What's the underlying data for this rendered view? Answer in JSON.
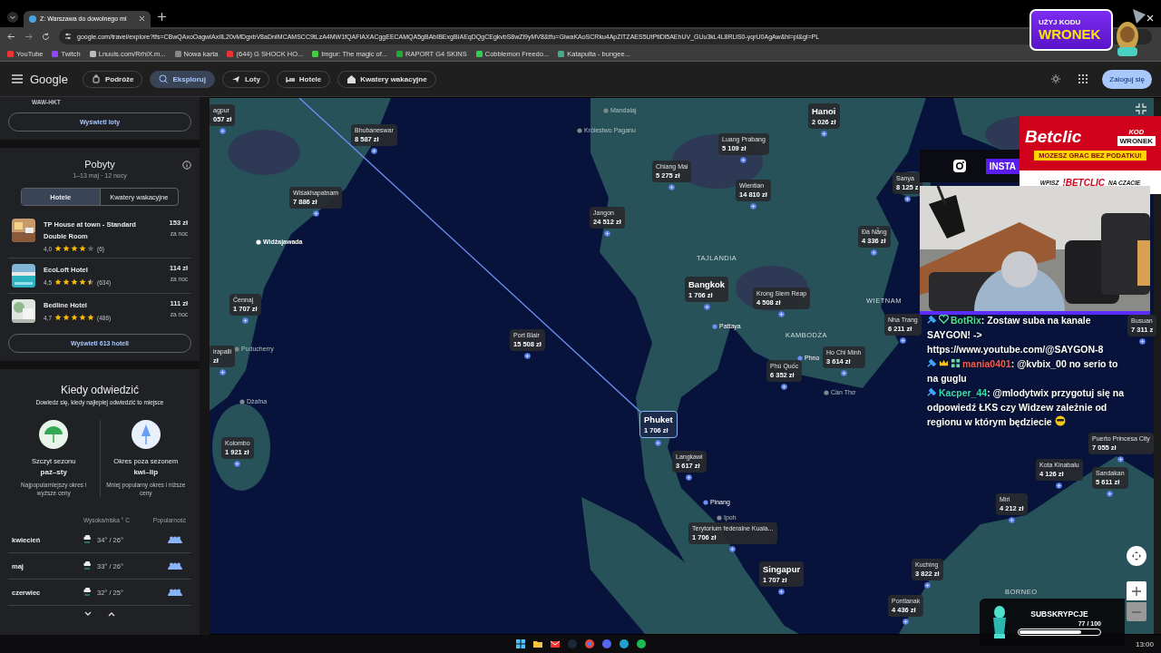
{
  "browser": {
    "tabs": [
      {
        "title": "Z: Warszawa do dowolnego mi",
        "selected": true
      }
    ],
    "url": "google.com/travel/explore?tfs=CBwQAxoOagwIAxIIL20vMDgxbV8aDnIMCAMSCC9tLzA4MW1fQAFIAXACggEECAMQA5gBAbIBExgBIAEqDQgCEgkvbS8wZl9yMV8&tfu=GiwaKAoSCRku4ApZiTZAES5UtPtiDl5AEhUV_GUu3kL4L8RLlS0-yqrU0AgAw&hl=pl&gl=PL",
    "bookmarks": [
      "YouTube",
      "Twitch",
      "Lnuuls.com/RrhiX.m...",
      "Nowa karta",
      "(644) G SHOCK HO...",
      "Imgur: The magic of...",
      "RAPORT G4 SKINS",
      "Cobblemon Freedo...",
      "Katapulta - bungee..."
    ]
  },
  "header": {
    "logo": "Google",
    "nav": [
      {
        "label": "Podróże",
        "selected": false
      },
      {
        "label": "Eksploruj",
        "selected": true
      },
      {
        "label": "Loty",
        "selected": false
      },
      {
        "label": "Hotele",
        "selected": false
      },
      {
        "label": "Kwatery wakacyjne",
        "selected": false
      }
    ],
    "login": "Zaloguj się"
  },
  "sidebar": {
    "flights": {
      "route": "WAW-HKT",
      "button": "Wyświetl loty"
    },
    "stays": {
      "title": "Pobyty",
      "dates": "1–13 maj · 12 nocy",
      "toggle": [
        {
          "label": "Hotele",
          "selected": true
        },
        {
          "label": "Kwatery wakacyjne",
          "selected": false
        }
      ],
      "hotels": [
        {
          "name": "TP House at town - Standard Double Room",
          "rating": "4,0",
          "stars": 4,
          "reviews": "(6)",
          "price": "153 zł",
          "unit": "za noc"
        },
        {
          "name": "EcoLoft Hotel",
          "rating": "4,5",
          "stars": 4.5,
          "reviews": "(634)",
          "price": "114 zł",
          "unit": "za noc"
        },
        {
          "name": "Bedline Hotel",
          "rating": "4,7",
          "stars": 5,
          "reviews": "(486)",
          "price": "111 zł",
          "unit": "za noc"
        }
      ],
      "button": "Wyświetl 613 hoteli"
    },
    "when": {
      "title": "Kiedy odwiedzić",
      "subtitle": "Dowiedz się, kiedy najlepiej odwiedzić to miejsce",
      "seasons": [
        {
          "kind": "peak",
          "label": "Szczyt sezonu",
          "months": "paź–sty",
          "note": "Najpopularniejszy okres i wyższe ceny"
        },
        {
          "kind": "off",
          "label": "Okres poza sezonem",
          "months": "kwi–lip",
          "note": "Mniej popularny okres i niższe ceny"
        }
      ],
      "columns": [
        "Wysoka/niska ° C",
        "Popularność"
      ],
      "months": [
        {
          "month": "kwiecień",
          "temps": "34° / 26°"
        },
        {
          "month": "maj",
          "temps": "33° / 26°"
        },
        {
          "month": "czerwiec",
          "temps": "32° / 25°"
        }
      ]
    }
  },
  "map": {
    "markers": [
      {
        "name": "agpur",
        "price": "057 zł",
        "kind": "minor",
        "selected": false
      },
      {
        "name": "Bhubaneswar",
        "price": "8 587 zł",
        "kind": "minor",
        "selected": false
      },
      {
        "name": "Wiśakhapatnam",
        "price": "7 886 zł",
        "kind": "minor",
        "selected": false
      },
      {
        "name": "Chiang Mai",
        "price": "5 275 zł",
        "kind": "minor",
        "selected": false
      },
      {
        "name": "Luang Prabang",
        "price": "5 109 zł",
        "kind": "minor",
        "selected": false
      },
      {
        "name": "Hanoi",
        "price": "2 026 zł",
        "kind": "major",
        "selected": false
      },
      {
        "name": "Jangon",
        "price": "24 512 zł",
        "kind": "minor",
        "selected": false
      },
      {
        "name": "Wientian",
        "price": "14 810 zł",
        "kind": "minor",
        "selected": false
      },
      {
        "name": "Sanya",
        "price": "8 125 z",
        "kind": "minor",
        "selected": false
      },
      {
        "name": "Đà Nẵng",
        "price": "4 336 zł",
        "kind": "minor",
        "selected": false
      },
      {
        "name": "Bangkok",
        "price": "1 706 zł",
        "kind": "major",
        "selected": false
      },
      {
        "name": "Krong Siem Reap",
        "price": "4 508 zł",
        "kind": "minor",
        "selected": false
      },
      {
        "name": "Ćennaj",
        "price": "1 707 zł",
        "kind": "minor",
        "selected": false
      },
      {
        "name": "irapalli",
        "price": "zł",
        "kind": "minor",
        "selected": false
      },
      {
        "name": "Nha Trang",
        "price": "6 211 zł",
        "kind": "minor",
        "selected": false
      },
      {
        "name": "Port Blair",
        "price": "15 508 zł",
        "kind": "minor",
        "selected": false
      },
      {
        "name": "Ho Chi Minh",
        "price": "3 614 zł",
        "kind": "minor",
        "selected": false
      },
      {
        "name": "Phú Quốc",
        "price": "6 352 zł",
        "kind": "minor",
        "selected": false
      },
      {
        "name": "Phuket",
        "price": "1 706 zł",
        "kind": "major",
        "selected": true
      },
      {
        "name": "Kolombo",
        "price": "1 921 zł",
        "kind": "minor",
        "selected": false
      },
      {
        "name": "Langkawi",
        "price": "3 617 zł",
        "kind": "minor",
        "selected": false
      },
      {
        "name": "Terytorium federalne Kuala...",
        "price": "1 706 zł",
        "kind": "minor",
        "selected": false
      },
      {
        "name": "Singapur",
        "price": "1 707 zł",
        "kind": "major",
        "selected": false
      },
      {
        "name": "Busuan",
        "price": "7 311 z",
        "kind": "minor",
        "selected": false
      },
      {
        "name": "Puerto Princesa City",
        "price": "7 055 zł",
        "kind": "minor",
        "selected": false
      },
      {
        "name": "Kota Kinabalu",
        "price": "4 126 zł",
        "kind": "minor",
        "selected": false
      },
      {
        "name": "Sandakan",
        "price": "5 611 zł",
        "kind": "minor",
        "selected": false
      },
      {
        "name": "Miri",
        "price": "4 212 zł",
        "kind": "minor",
        "selected": false
      },
      {
        "name": "Kuching",
        "price": "3 822 zł",
        "kind": "minor",
        "selected": false
      },
      {
        "name": "Pontianak",
        "price": "4 436 zł",
        "kind": "minor",
        "selected": false
      }
    ],
    "places": [
      {
        "name": "Widżajawada",
        "kind": "city"
      },
      {
        "name": "Puducherry",
        "kind": "town"
      },
      {
        "name": "Dżafna",
        "kind": "town"
      },
      {
        "name": "Mandalaj",
        "kind": "town"
      },
      {
        "name": "Królestwo Paganu",
        "kind": "town"
      },
      {
        "name": "TAJLANDIA",
        "kind": "region"
      },
      {
        "name": "WIETNAM",
        "kind": "region"
      },
      {
        "name": "KAMBODŻA",
        "kind": "region"
      },
      {
        "name": "Pattaya",
        "kind": "airport"
      },
      {
        "name": "Phno",
        "kind": "airport"
      },
      {
        "name": "Cần Thơ",
        "kind": "town"
      },
      {
        "name": "Pinang",
        "kind": "airport"
      },
      {
        "name": "Ipoh",
        "kind": "town"
      },
      {
        "name": "BORNEO",
        "kind": "region"
      }
    ]
  },
  "stream": {
    "promo": {
      "line1": "UŻYJ KODU",
      "line2": "WRONEK"
    },
    "betclic": {
      "brand": "Betclic",
      "code_label": "KOD",
      "code": "WRONEK",
      "banner": "MOZESZ GRAC BEZ PODATKU!",
      "cta1": "WPISZ",
      "cta2": "!BETCLIC",
      "cta3": "NA CZACIE"
    },
    "instagram": "INSTA",
    "chat": [
      {
        "user": "BotRix",
        "color": "#4ee08a",
        "text": ": Zostaw suba na kanale SAYGON! -> https://www.youtube.com/@SAYGON-8",
        "emoji": false
      },
      {
        "user": "mania0401",
        "color": "#ff5a4e",
        "text": ": @kvbix_00 no serio to na guglu",
        "emoji": false
      },
      {
        "user": "Kacper_44",
        "color": "#2fe0b0",
        "text": ": @mlodytwix przygotuj się na odpowiedź ŁKS czy Widzew zależnie od regionu w którym będziecie",
        "emoji": true
      }
    ],
    "subs": {
      "label": "SUBSKRYPCJE",
      "count": "77 / 100",
      "level": 0.77
    }
  },
  "taskbar": {
    "time": "13:00"
  }
}
